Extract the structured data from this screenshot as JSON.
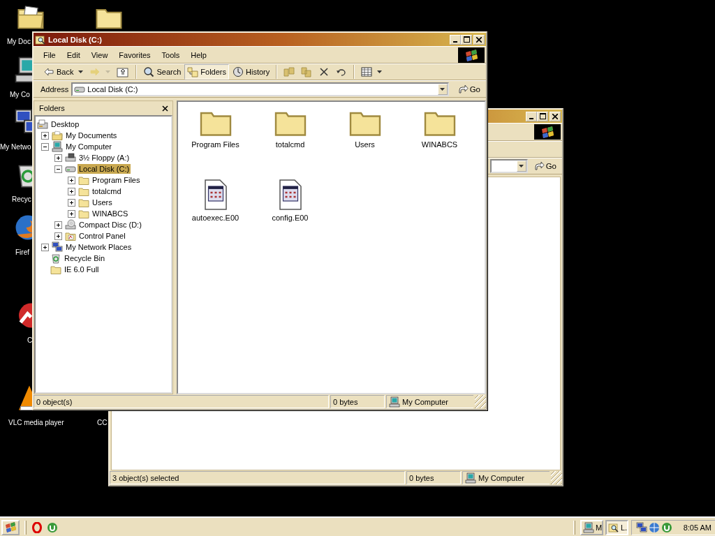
{
  "desktop_icons": [
    {
      "kind": "documents",
      "label": "My Doc"
    },
    {
      "kind": "folder"
    },
    {
      "kind": "computer",
      "label": "My Co"
    },
    {
      "kind": "network",
      "label": "My Netwo"
    },
    {
      "kind": "recycle",
      "label": "Recyc"
    },
    {
      "kind": "firefox",
      "label": "Firef"
    },
    {
      "kind": "redapp",
      "label": "C"
    },
    {
      "kind": "vlc",
      "label": "VLC media player"
    },
    {
      "label": "CC"
    }
  ],
  "back_window": {
    "go": "Go",
    "status": [
      "3 object(s) selected",
      "0 bytes",
      "My Computer"
    ]
  },
  "window": {
    "title": "Local Disk (C:)",
    "menu": [
      "File",
      "Edit",
      "View",
      "Favorites",
      "Tools",
      "Help"
    ],
    "toolbar": [
      {
        "kind": "back",
        "label": "Back",
        "disabled": false,
        "dropdown": true,
        "selected": false
      },
      {
        "kind": "forward",
        "disabled": true,
        "dropdown": true,
        "selected": false
      },
      {
        "kind": "up",
        "disabled": false,
        "dropdown": false,
        "selected": false
      },
      {
        "kind": "sep"
      },
      {
        "kind": "search",
        "label": "Search",
        "disabled": false,
        "dropdown": false,
        "selected": false
      },
      {
        "kind": "folders",
        "label": "Folders",
        "disabled": false,
        "dropdown": false,
        "selected": true
      },
      {
        "kind": "history",
        "label": "History",
        "disabled": false,
        "dropdown": false,
        "selected": false
      },
      {
        "kind": "sep"
      },
      {
        "kind": "moveto",
        "disabled": false,
        "dropdown": false,
        "selected": false
      },
      {
        "kind": "copyto",
        "disabled": false,
        "dropdown": false,
        "selected": false
      },
      {
        "kind": "delete",
        "disabled": false,
        "dropdown": false,
        "selected": false
      },
      {
        "kind": "undo",
        "disabled": false,
        "dropdown": false,
        "selected": false
      },
      {
        "kind": "sep"
      },
      {
        "kind": "views",
        "disabled": false,
        "dropdown": true,
        "selected": false
      }
    ],
    "address": {
      "label": "Address",
      "value": "Local Disk (C:)",
      "go": "Go"
    },
    "folders_pane": {
      "title": "Folders",
      "tree": [
        {
          "kind": "desktop",
          "label": "Desktop",
          "expandable": false,
          "selected": false,
          "children": [
            {
              "kind": "documents",
              "label": "My Documents",
              "expandable": true,
              "expanded": false,
              "selected": false
            },
            {
              "kind": "computer",
              "label": "My Computer",
              "expandable": true,
              "expanded": true,
              "selected": false,
              "children": [
                {
                  "kind": "floppy",
                  "label": "3½ Floppy (A:)",
                  "expandable": true,
                  "expanded": false,
                  "selected": false
                },
                {
                  "kind": "disk",
                  "label": "Local Disk (C:)",
                  "expandable": true,
                  "expanded": true,
                  "selected": true,
                  "children": [
                    {
                      "kind": "folder",
                      "label": "Program Files",
                      "expandable": true,
                      "expanded": false,
                      "selected": false
                    },
                    {
                      "kind": "folder",
                      "label": "totalcmd",
                      "expandable": true,
                      "expanded": false,
                      "selected": false
                    },
                    {
                      "kind": "folder",
                      "label": "Users",
                      "expandable": true,
                      "expanded": false,
                      "selected": false
                    },
                    {
                      "kind": "folder",
                      "label": "WINABCS",
                      "expandable": true,
                      "expanded": false,
                      "selected": false
                    }
                  ]
                },
                {
                  "kind": "cd",
                  "label": "Compact Disc (D:)",
                  "expandable": true,
                  "expanded": false,
                  "selected": false
                },
                {
                  "kind": "control",
                  "label": "Control Panel",
                  "expandable": true,
                  "expanded": false,
                  "selected": false
                }
              ]
            },
            {
              "kind": "network",
              "label": "My Network Places",
              "expandable": true,
              "expanded": false,
              "selected": false
            },
            {
              "kind": "recycle",
              "label": "Recycle Bin",
              "expandable": false,
              "selected": false
            },
            {
              "kind": "folder",
              "label": "IE 6.0 Full",
              "expandable": false,
              "selected": false
            }
          ]
        }
      ]
    },
    "files": [
      {
        "kind": "folder",
        "name": "Program Files"
      },
      {
        "kind": "folder",
        "name": "totalcmd"
      },
      {
        "kind": "folder",
        "name": "Users"
      },
      {
        "kind": "folder",
        "name": "WINABCS"
      },
      {
        "kind": "file",
        "name": "autoexec.E00"
      },
      {
        "kind": "file",
        "name": "config.E00"
      }
    ],
    "status": [
      "0 object(s)",
      "0 bytes",
      "My Computer"
    ]
  },
  "taskbar": {
    "quick_launch": [
      {
        "kind": "opera"
      },
      {
        "kind": "utorrent"
      }
    ],
    "tasks": [
      {
        "label": "M",
        "kind": "computer",
        "selected": false
      },
      {
        "label": "L.",
        "kind": "search",
        "selected": true
      }
    ],
    "tray": [
      {
        "kind": "network"
      },
      {
        "kind": "globe"
      },
      {
        "kind": "utorrent"
      }
    ],
    "clock": "8:05 AM"
  }
}
